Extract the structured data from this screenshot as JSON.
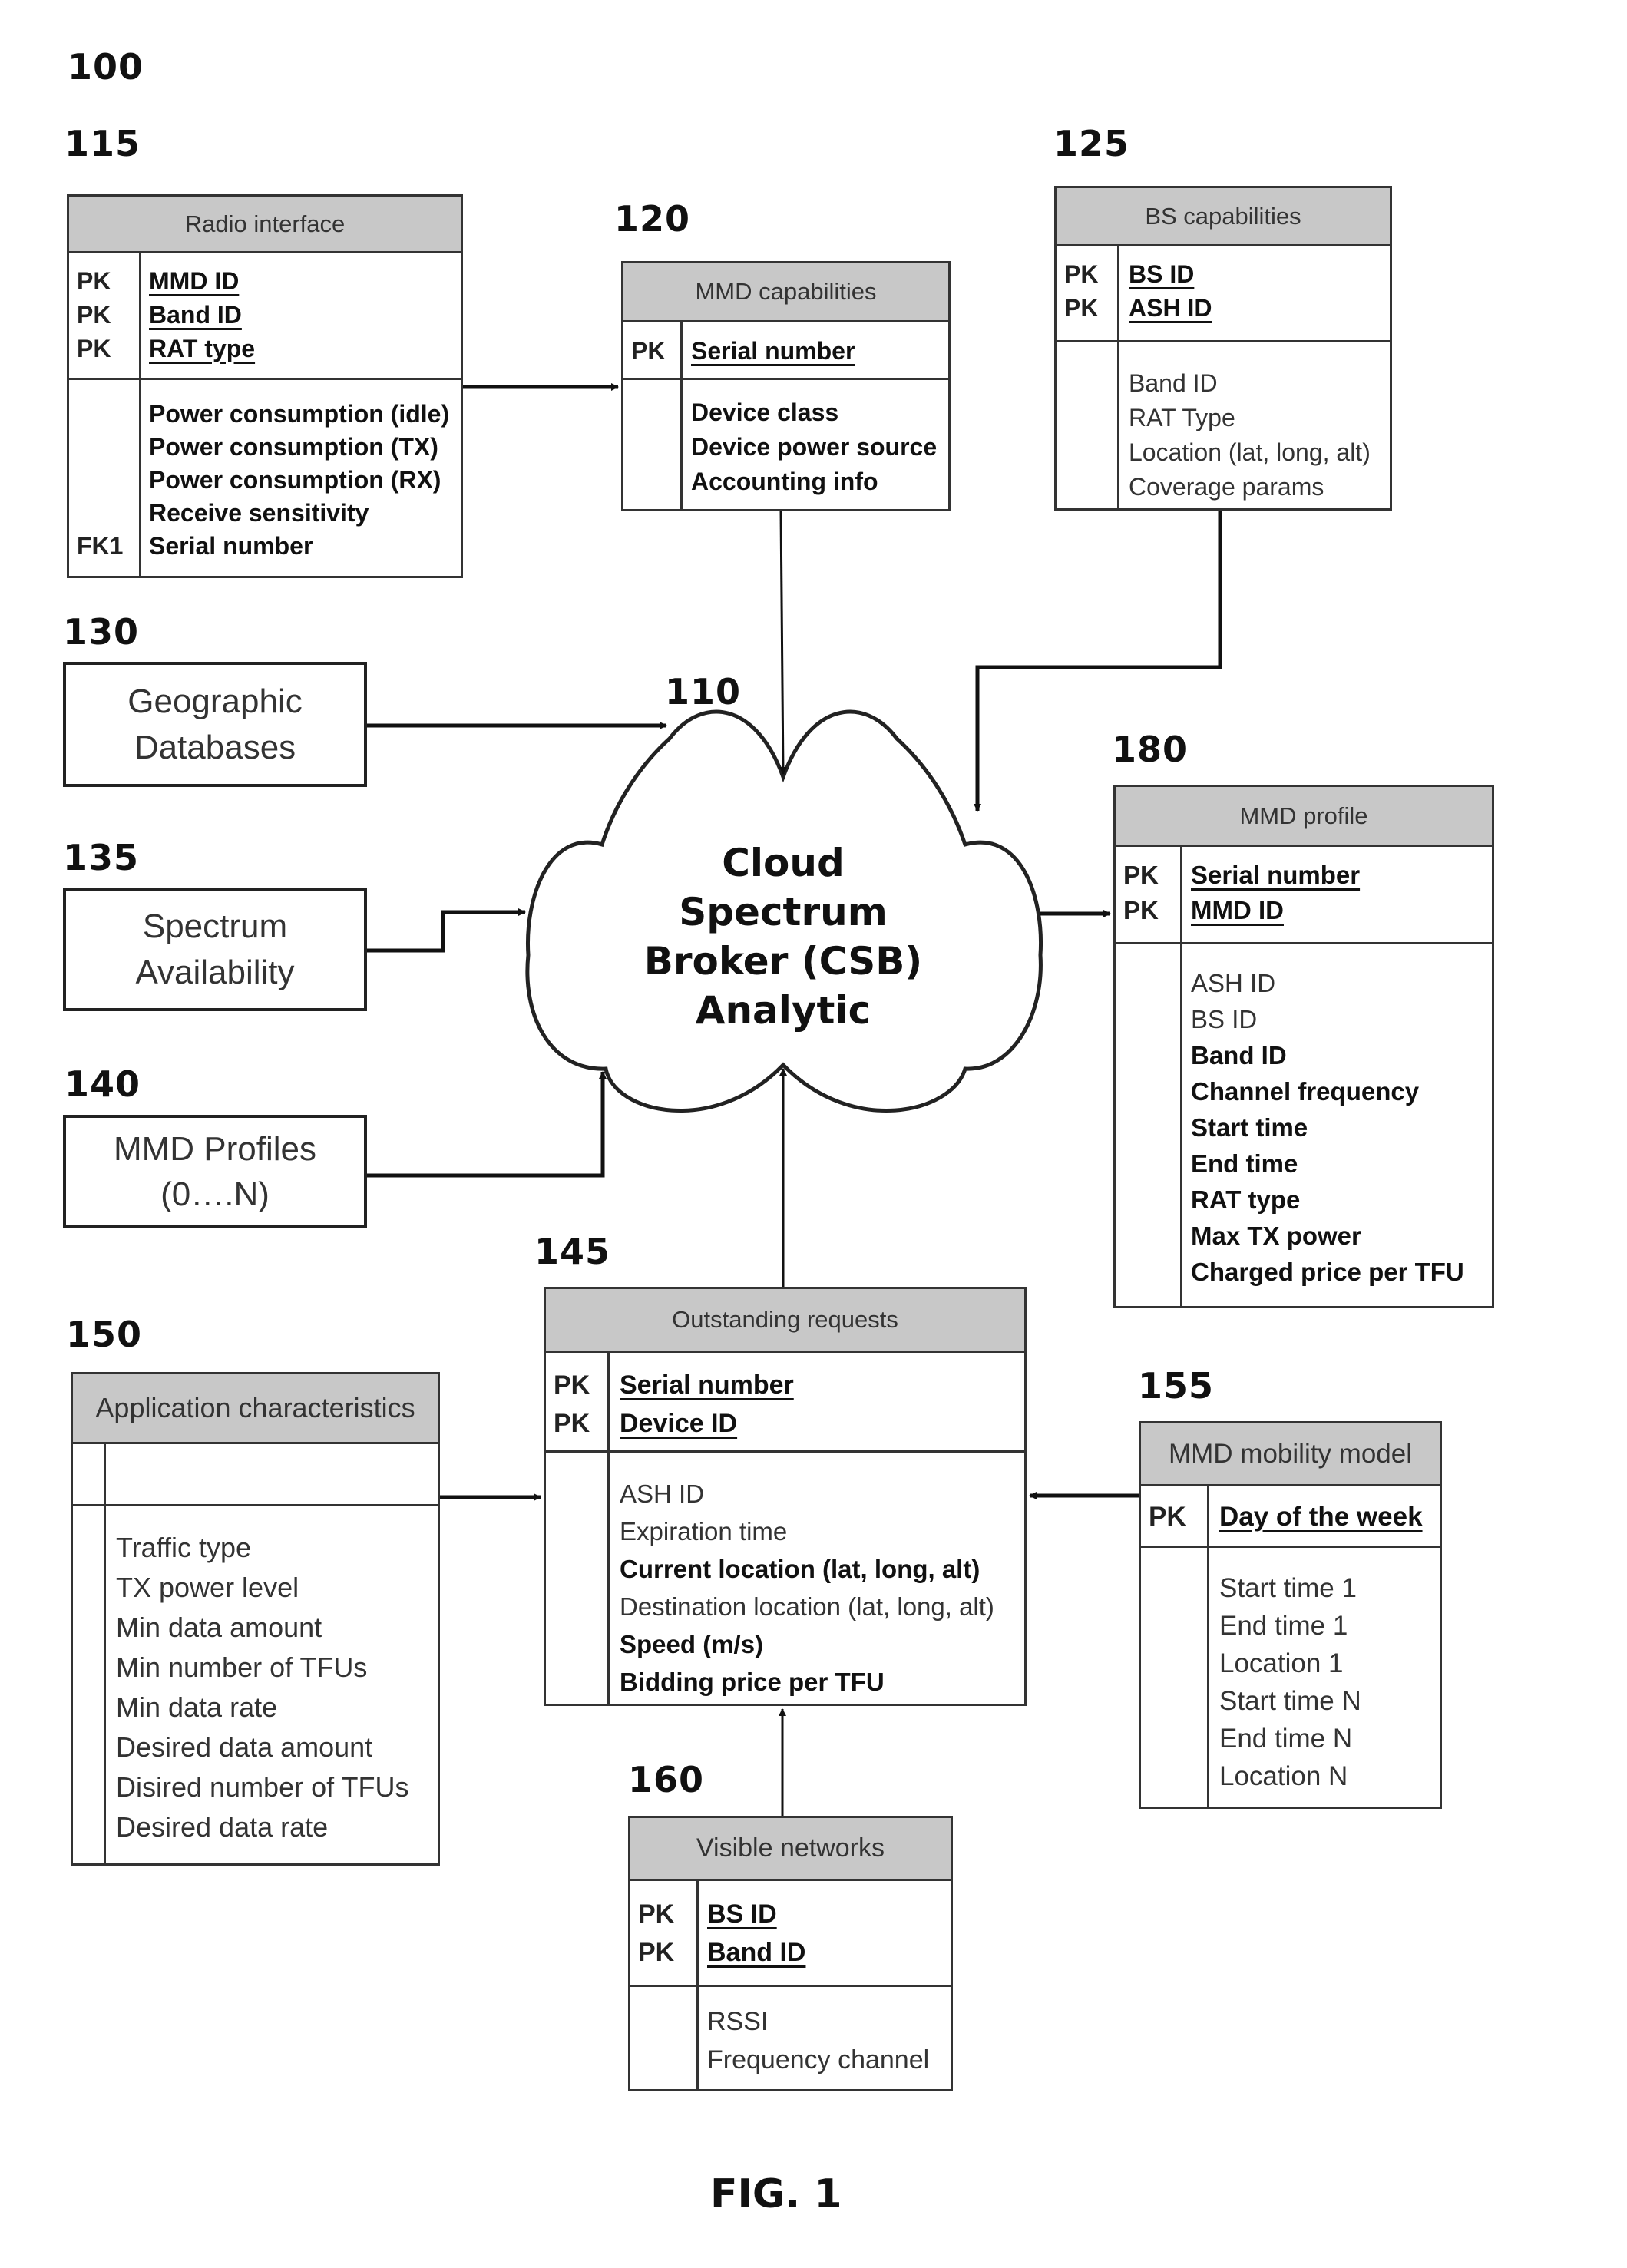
{
  "figure": {
    "ref_main": "100",
    "caption": "FIG. 1"
  },
  "csb": {
    "ref": "110",
    "lines": [
      "Cloud",
      "Spectrum",
      "Broker (CSB)",
      "Analytic"
    ]
  },
  "radio_interface": {
    "ref": "115",
    "title": "Radio interface",
    "key_tags": [
      "PK",
      "PK",
      "PK"
    ],
    "keys": [
      "MMD ID",
      "Band ID",
      "RAT type"
    ],
    "attr_tags": [
      "",
      "",
      "",
      "",
      "FK1"
    ],
    "attrs": [
      "Power consumption  (idle)",
      "Power consumption  (TX)",
      "Power consumption  (RX)",
      "Receive sensitivity",
      "Serial number"
    ]
  },
  "mmd_capabilities": {
    "ref": "120",
    "title": "MMD capabilities",
    "key_tags": [
      "PK"
    ],
    "keys": [
      "Serial number"
    ],
    "attrs": [
      "Device class",
      "Device power source",
      "Accounting info"
    ]
  },
  "bs_capabilities": {
    "ref": "125",
    "title": "BS capabilities",
    "key_tags": [
      "PK",
      "PK"
    ],
    "keys": [
      "BS ID",
      "ASH ID"
    ],
    "attrs": [
      "Band ID",
      "RAT Type",
      "Location (lat, long, alt)",
      "Coverage params"
    ]
  },
  "geographic_databases": {
    "ref": "130",
    "lines": [
      "Geographic",
      "Databases"
    ]
  },
  "spectrum_availability": {
    "ref": "135",
    "lines": [
      "Spectrum",
      "Availability"
    ]
  },
  "mmd_profiles": {
    "ref": "140",
    "lines": [
      "MMD Profiles",
      "(0….N)"
    ]
  },
  "outstanding_requests": {
    "ref": "145",
    "title": "Outstanding requests",
    "key_tags": [
      "PK",
      "PK"
    ],
    "keys": [
      "Serial number",
      "Device ID"
    ],
    "attrs": [
      "ASH ID",
      "Expiration time",
      "Current location (lat, long, alt)",
      "Destination location (lat, long, alt)",
      "Speed (m/s)",
      "Bidding price per TFU"
    ]
  },
  "application_characteristics": {
    "ref": "150",
    "title": "Application characteristics",
    "attrs": [
      "Traffic type",
      "TX power level",
      "Min data amount",
      "Min number of TFUs",
      "Min data rate",
      "Desired data amount",
      "Disired number of TFUs",
      "Desired data rate"
    ]
  },
  "mmd_mobility_model": {
    "ref": "155",
    "title": "MMD mobility model",
    "key_tags": [
      "PK"
    ],
    "keys": [
      "Day of the week"
    ],
    "attrs": [
      "Start time 1",
      "End time 1",
      "Location 1",
      "Start time N",
      "End time N",
      "Location N"
    ]
  },
  "visible_networks": {
    "ref": "160",
    "title": "Visible networks",
    "key_tags": [
      "PK",
      "PK"
    ],
    "keys": [
      "BS ID",
      "Band ID"
    ],
    "attrs": [
      "RSSI",
      "Frequency channel"
    ]
  },
  "mmd_profile": {
    "ref": "180",
    "title": "MMD profile",
    "key_tags": [
      "PK",
      "PK"
    ],
    "keys": [
      "Serial number",
      "MMD ID"
    ],
    "attrs": [
      "ASH ID",
      "BS ID",
      "Band ID",
      "Channel frequency",
      "Start time",
      "End time",
      "RAT type",
      "Max TX power",
      "Charged price per TFU"
    ]
  }
}
